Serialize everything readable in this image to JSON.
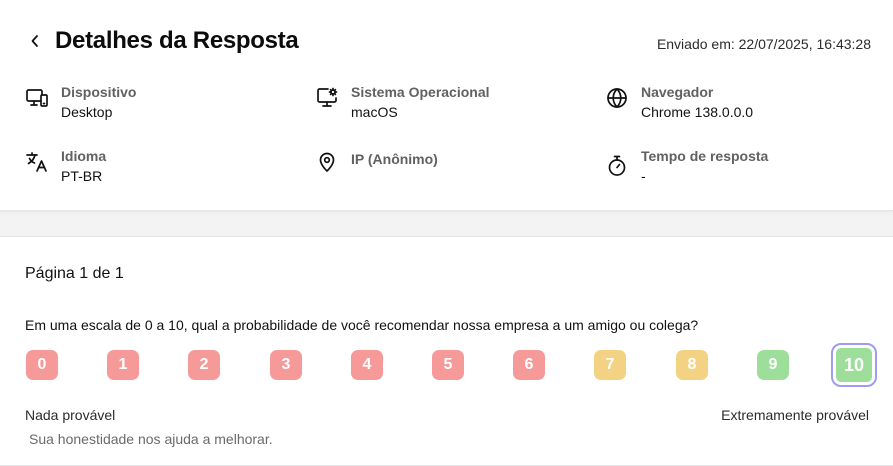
{
  "header": {
    "title": "Detalhes da Resposta",
    "sent_at": "Enviado em: 22/07/2025, 16:43:28"
  },
  "info": [
    {
      "icon": "desktop-icon",
      "label": "Dispositivo",
      "value": "Desktop"
    },
    {
      "icon": "monitor-settings-icon",
      "label": "Sistema Operacional",
      "value": "macOS"
    },
    {
      "icon": "globe-icon",
      "label": "Navegador",
      "value": "Chrome 138.0.0.0"
    },
    {
      "icon": "translate-icon",
      "label": "Idioma",
      "value": "PT-BR"
    },
    {
      "icon": "location-pin-icon",
      "label": "IP (Anônimo)",
      "value": ""
    },
    {
      "icon": "stopwatch-icon",
      "label": "Tempo de resposta",
      "value": "-"
    }
  ],
  "survey": {
    "page": "Página 1 de 1",
    "question": "Em uma escala de 0 a 10, qual a probabilidade de você recomendar nossa empresa a um amigo ou colega?",
    "scale": [
      {
        "label": "0",
        "color": "#f59a98"
      },
      {
        "label": "1",
        "color": "#f59a98"
      },
      {
        "label": "2",
        "color": "#f59a98"
      },
      {
        "label": "3",
        "color": "#f59a98"
      },
      {
        "label": "4",
        "color": "#f59a98"
      },
      {
        "label": "5",
        "color": "#f59a98"
      },
      {
        "label": "6",
        "color": "#f59a98"
      },
      {
        "label": "7",
        "color": "#f3d283"
      },
      {
        "label": "8",
        "color": "#f3d283"
      },
      {
        "label": "9",
        "color": "#9ddf9a"
      },
      {
        "label": "10",
        "color": "#9ddf9a"
      }
    ],
    "selected": "10",
    "low_label": "Nada provável",
    "high_label": "Extremamente provável",
    "helper": "Sua honestidade nos ajuda a melhorar."
  }
}
